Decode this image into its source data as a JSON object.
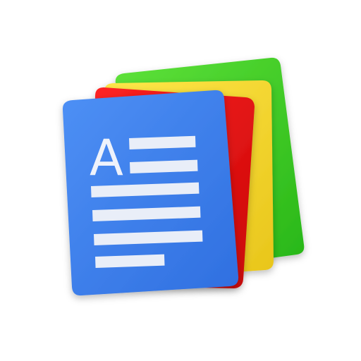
{
  "app_icon": {
    "glyph": "A",
    "colors": {
      "green_sheet": "#33cc1f",
      "yellow_sheet": "#f2d21c",
      "red_sheet": "#e00b0b",
      "blue_sheet": "#3f82f0",
      "text_lines": "#e9eef8"
    }
  }
}
